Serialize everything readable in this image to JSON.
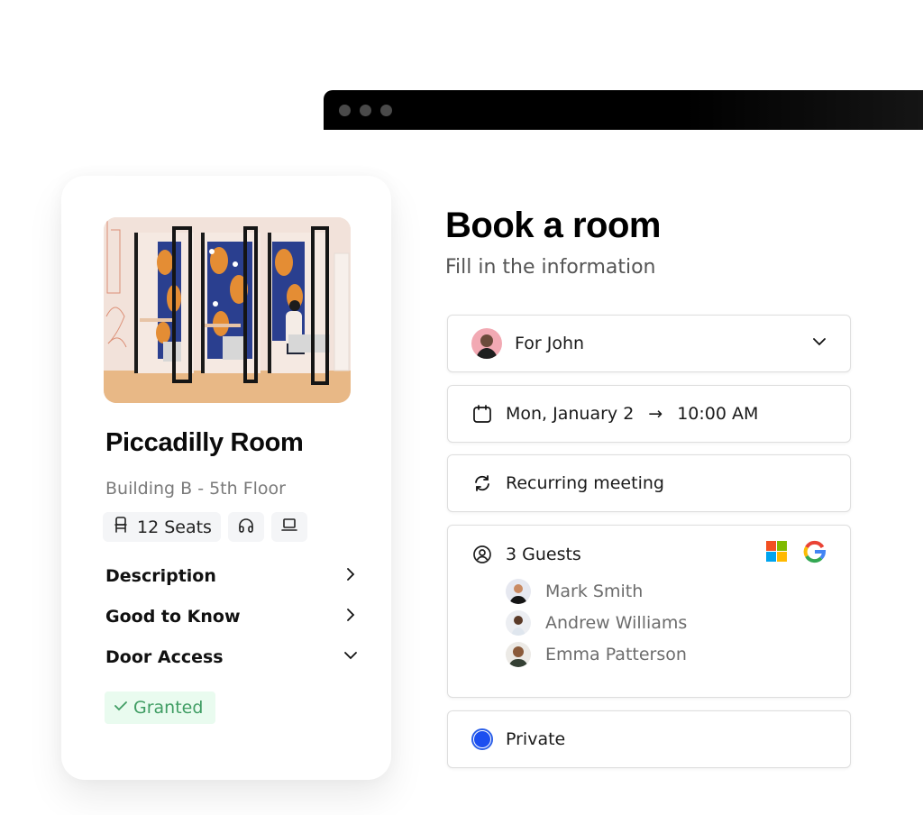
{
  "window": {
    "controls": [
      "dot",
      "dot",
      "dot"
    ]
  },
  "room": {
    "image_alt": "Meeting booths with patterned wallpaper",
    "title": "Piccadilly Room",
    "location": "Building B - 5th Floor",
    "amenities": [
      {
        "icon": "chair-icon",
        "label": "12 Seats"
      },
      {
        "icon": "headphones-icon",
        "label": ""
      },
      {
        "icon": "laptop-icon",
        "label": ""
      }
    ],
    "sections": [
      {
        "label": "Description",
        "icon": "chevron-right-icon"
      },
      {
        "label": "Good to Know",
        "icon": "chevron-right-icon"
      },
      {
        "label": "Door Access",
        "icon": "chevron-down-icon"
      }
    ],
    "door_access_status": "Granted",
    "status_color": "#3f9d63"
  },
  "booking": {
    "title": "Book a room",
    "subtitle": "Fill in the information",
    "for_user": "For John",
    "date": "Mon, January 2",
    "arrow": "→",
    "time": "10:00 AM",
    "recurring": "Recurring meeting",
    "guests_label": "3 Guests",
    "guests": [
      {
        "name": "Mark Smith"
      },
      {
        "name": "Andrew Williams"
      },
      {
        "name": "Emma Patterson"
      }
    ],
    "integrations": [
      "microsoft-icon",
      "google-icon"
    ],
    "privacy": "Private",
    "privacy_selected": true,
    "accent_color": "#1c4ff0"
  }
}
